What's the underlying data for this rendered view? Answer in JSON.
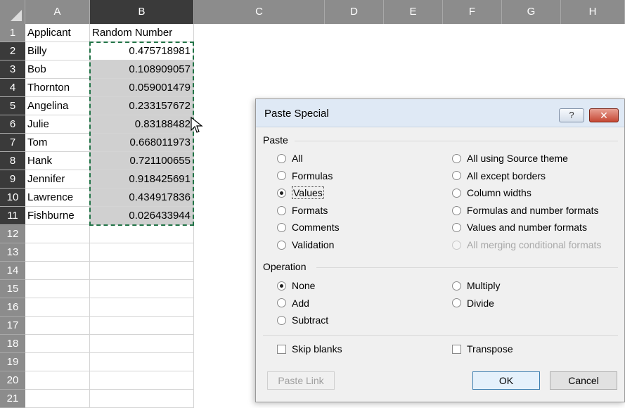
{
  "sheet": {
    "columns": [
      "A",
      "B",
      "C",
      "D",
      "E",
      "F",
      "G",
      "H"
    ],
    "row_numbers": [
      "1",
      "2",
      "3",
      "4",
      "5",
      "6",
      "7",
      "8",
      "9",
      "10",
      "11",
      "12",
      "13",
      "14",
      "15",
      "16",
      "17",
      "18",
      "19",
      "20",
      "21"
    ],
    "header_row": {
      "a": "Applicant",
      "b": "Random Number"
    },
    "rows": [
      {
        "a": "Billy",
        "b": "0.475718981"
      },
      {
        "a": "Bob",
        "b": "0.108909057"
      },
      {
        "a": "Thornton",
        "b": "0.059001479"
      },
      {
        "a": "Angelina",
        "b": "0.233157672"
      },
      {
        "a": "Julie",
        "b": "0.83188482"
      },
      {
        "a": "Tom",
        "b": "0.668011973"
      },
      {
        "a": "Hank",
        "b": "0.721100655"
      },
      {
        "a": "Jennifer",
        "b": "0.918425691"
      },
      {
        "a": "Lawrence",
        "b": "0.434917836"
      },
      {
        "a": "Fishburne",
        "b": "0.026433944"
      }
    ]
  },
  "dialog": {
    "title": "Paste Special",
    "help_label": "?",
    "close_label": "✕",
    "paste_group_label": "Paste",
    "paste_left": [
      {
        "label": "All",
        "checked": false
      },
      {
        "label": "Formulas",
        "checked": false
      },
      {
        "label": "Values",
        "checked": true
      },
      {
        "label": "Formats",
        "checked": false
      },
      {
        "label": "Comments",
        "checked": false
      },
      {
        "label": "Validation",
        "checked": false
      }
    ],
    "paste_right": [
      {
        "label": "All using Source theme",
        "checked": false,
        "disabled": false
      },
      {
        "label": "All except borders",
        "checked": false,
        "disabled": false
      },
      {
        "label": "Column widths",
        "checked": false,
        "disabled": false
      },
      {
        "label": "Formulas and number formats",
        "checked": false,
        "disabled": false
      },
      {
        "label": "Values and number formats",
        "checked": false,
        "disabled": false
      },
      {
        "label": "All merging conditional formats",
        "checked": false,
        "disabled": true
      }
    ],
    "operation_group_label": "Operation",
    "operation_left": [
      {
        "label": "None",
        "checked": true
      },
      {
        "label": "Add",
        "checked": false
      },
      {
        "label": "Subtract",
        "checked": false
      }
    ],
    "operation_right": [
      {
        "label": "Multiply",
        "checked": false
      },
      {
        "label": "Divide",
        "checked": false
      }
    ],
    "skip_blanks_label": "Skip blanks",
    "transpose_label": "Transpose",
    "paste_link_label": "Paste Link",
    "ok_label": "OK",
    "cancel_label": "Cancel"
  },
  "colors": {
    "header_bg": "#8c8c8c",
    "header_active_bg": "#3a3a3a",
    "selection_bg": "#d0d0d0",
    "marching_ants": "#217346",
    "dialog_bg": "#f0f0f0",
    "close_button": "#c54834"
  }
}
